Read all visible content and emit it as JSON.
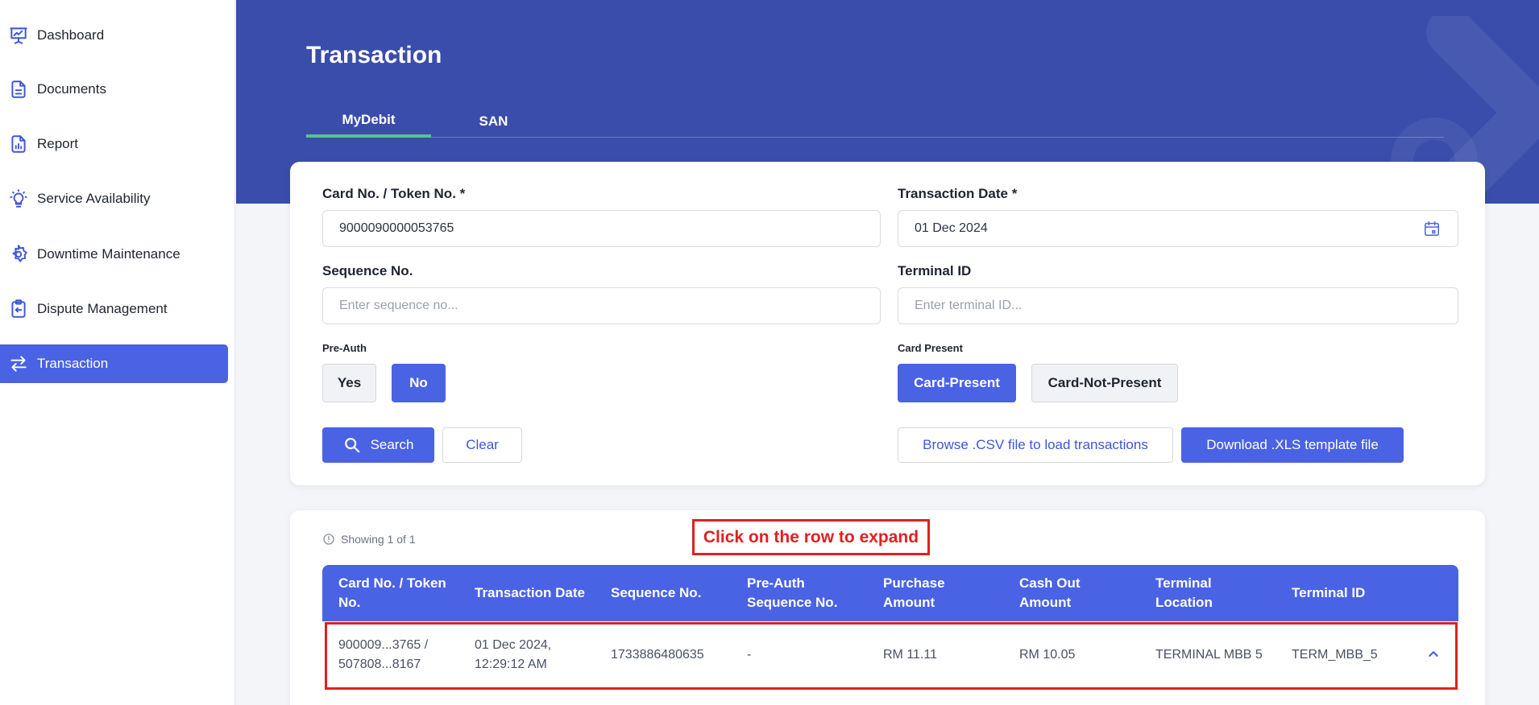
{
  "sidebar": {
    "items": [
      {
        "label": "Dashboard",
        "icon": "presentation-chart-icon"
      },
      {
        "label": "Documents",
        "icon": "document-icon"
      },
      {
        "label": "Report",
        "icon": "report-icon"
      },
      {
        "label": "Service Availability",
        "icon": "lightbulb-icon"
      },
      {
        "label": "Downtime Maintenance",
        "icon": "gear-icon"
      },
      {
        "label": "Dispute Management",
        "icon": "clipboard-icon"
      },
      {
        "label": "Transaction",
        "icon": "swap-arrows-icon",
        "active": true
      }
    ]
  },
  "header": {
    "title": "Transaction",
    "tabs": [
      {
        "label": "MyDebit",
        "active": true
      },
      {
        "label": "SAN",
        "active": false
      }
    ]
  },
  "form": {
    "card_no": {
      "label": "Card No. / Token No. *",
      "value": "9000090000053765",
      "placeholder": ""
    },
    "transaction_date": {
      "label": "Transaction Date *",
      "value": "01 Dec 2024"
    },
    "sequence_no": {
      "label": "Sequence No.",
      "placeholder": "Enter sequence no..."
    },
    "terminal_id": {
      "label": "Terminal ID",
      "placeholder": "Enter terminal ID..."
    },
    "pre_auth": {
      "label": "Pre-Auth",
      "options": [
        "Yes",
        "No"
      ],
      "selected": "No"
    },
    "card_present": {
      "label": "Card Present",
      "options": [
        "Card-Present",
        "Card-Not-Present"
      ],
      "selected": "Card-Present"
    },
    "search_label": "Search",
    "clear_label": "Clear",
    "browse_label": "Browse .CSV file to load transactions",
    "download_label": "Download .XLS template file"
  },
  "results": {
    "showing": "Showing 1 of 1",
    "hint": "Click on the row to expand",
    "columns": [
      "Card No. / Token No.",
      "Transaction Date",
      "Sequence No.",
      "Pre-Auth Sequence No.",
      "Purchase Amount",
      "Cash Out Amount",
      "Terminal Location",
      "Terminal ID"
    ],
    "rows": [
      {
        "card_no": "900009...3765 / 507808...8167",
        "transaction_date": "01 Dec 2024, 12:29:12 AM",
        "sequence_no": "1733886480635",
        "pre_auth_seq": "-",
        "purchase_amount": "RM 11.11",
        "cash_out_amount": "RM 10.05",
        "terminal_location": "TERMINAL MBB 5",
        "terminal_id": "TERM_MBB_5"
      }
    ]
  },
  "colors": {
    "primary": "#4a62e4",
    "banner": "#3a4dab",
    "tab_indicator": "#58c28a",
    "annotation": "#e02020"
  }
}
